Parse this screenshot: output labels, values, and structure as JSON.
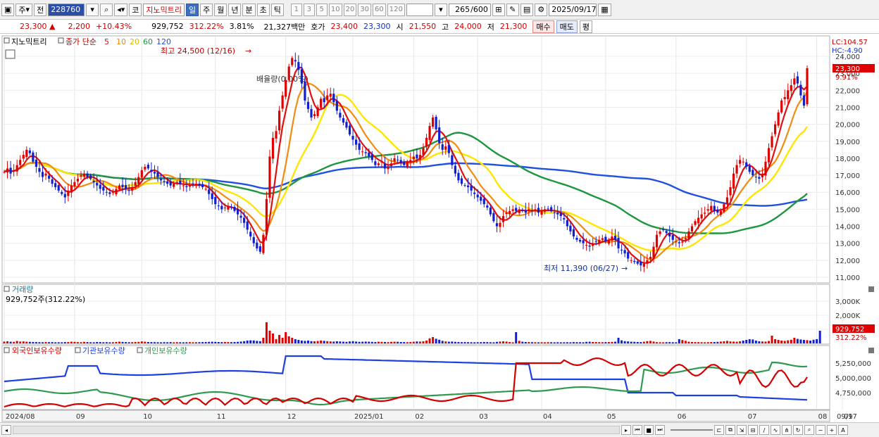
{
  "toolbar": {
    "market_label": "주",
    "prev_label": "전",
    "code": "228760",
    "type_label": "코",
    "stock_name": "지노믹트리",
    "period_tabs": [
      "일",
      "주",
      "월",
      "년",
      "분",
      "초",
      "틱"
    ],
    "active_period": "일",
    "intervals": [
      "1",
      "3",
      "5",
      "10",
      "20",
      "30",
      "60",
      "120"
    ],
    "count": "265",
    "count_total": "/600",
    "date": "2025/09/17"
  },
  "info": {
    "price": "23,300",
    "change": "2,200",
    "change_pct": "+10.43%",
    "volume": "929,752",
    "volume_pct": "312.22%",
    "turnover": "3.81%",
    "amount": "21,327백만",
    "quote_label": "호가",
    "ask": "23,400",
    "bid": "23,300",
    "open_label": "시",
    "open": "21,550",
    "high_label": "고",
    "high": "24,000",
    "low_label": "저",
    "low": "21,300",
    "buy_label": "매수",
    "sell_label": "매도",
    "eval_label": "평"
  },
  "price_panel": {
    "name": "지노믹트리",
    "ma_title": "종가 단순",
    "ma_periods": [
      "5",
      "10",
      "20",
      "60",
      "120"
    ],
    "ma_colors": [
      "#e01010",
      "#f08c10",
      "#ffe600",
      "#1e9640",
      "#2050e0"
    ],
    "high_annotation": "최고 24,500 (12/16)",
    "low_annotation": "최저 11,390 (06/27)",
    "ratio_label": "배율량(0.00%)",
    "lc": "LC:104.57",
    "hc": "HC:-4.90",
    "current_price": "23,300",
    "current_pct": "9.91%",
    "y_ticks": [
      "24,000",
      "23,000",
      "22,000",
      "21,000",
      "20,000",
      "19,000",
      "18,000",
      "17,000",
      "16,000",
      "15,000",
      "14,000",
      "13,000",
      "12,000",
      "11,000"
    ]
  },
  "volume_panel": {
    "title": "거래량",
    "value": "929,752주(312.22%)",
    "y_ticks": [
      "3,000K",
      "2,000K",
      "1,000K"
    ],
    "current": "929,752",
    "current_pct": "312.22%"
  },
  "holdings_panel": {
    "series": [
      "외국인보유수량",
      "기관보유수량",
      "개인보유수량"
    ],
    "colors": [
      "#d40000",
      "#1e40e0",
      "#2e9a50"
    ],
    "y_ticks": [
      "5,250,000",
      "5,000,000",
      "4,750,000"
    ]
  },
  "x_labels": [
    "2024/08",
    "09",
    "10",
    "11",
    "12",
    "2025/01",
    "02",
    "03",
    "04",
    "05",
    "06",
    "07",
    "08",
    "09",
    "09/17"
  ],
  "chart_data": {
    "type": "candlestick",
    "ylim": [
      11000,
      24500
    ],
    "closes": [
      17200,
      17400,
      17100,
      17300,
      17600,
      17900,
      18200,
      18500,
      18300,
      17800,
      17500,
      17200,
      16900,
      17100,
      16800,
      16500,
      16300,
      16100,
      15900,
      15700,
      16100,
      16400,
      16600,
      16800,
      17000,
      17100,
      16900,
      16800,
      16600,
      16400,
      16200,
      16100,
      16000,
      15900,
      16000,
      16200,
      16400,
      16300,
      16200,
      16100,
      16300,
      16600,
      16900,
      17300,
      17500,
      17400,
      17200,
      17100,
      16900,
      16700,
      16600,
      16500,
      16400,
      16500,
      16600,
      16500,
      16400,
      16300,
      16400,
      16500,
      16500,
      16400,
      16300,
      16200,
      15900,
      15600,
      15300,
      15200,
      15000,
      15100,
      15200,
      15100,
      14900,
      14700,
      14500,
      14200,
      13800,
      13400,
      13000,
      12700,
      12500,
      13500,
      15600,
      18100,
      19200,
      19600,
      20800,
      21700,
      22600,
      23400,
      23900,
      23700,
      23200,
      22400,
      21400,
      20900,
      20400,
      20600,
      21000,
      21500,
      21300,
      21700,
      21800,
      21300,
      20800,
      20400,
      20100,
      19800,
      19400,
      19100,
      18800,
      18500,
      18400,
      18300,
      18100,
      17900,
      17600,
      17700,
      17800,
      17400,
      17500,
      17700,
      18000,
      17900,
      17700,
      17600,
      17800,
      17900,
      18100,
      18000,
      18200,
      18600,
      19200,
      19900,
      20400,
      19700,
      18900,
      18500,
      18700,
      18300,
      17600,
      17100,
      16700,
      16500,
      16400,
      16300,
      16100,
      15900,
      15700,
      15500,
      15300,
      15100,
      14700,
      14300,
      14000,
      14200,
      14600,
      14800,
      14900,
      15000,
      14900,
      15000,
      14900,
      14800,
      15000,
      14900,
      15000,
      14800,
      14900,
      15000,
      15000,
      14900,
      14800,
      14700,
      14600,
      14400,
      14000,
      13700,
      13400,
      13200,
      13100,
      13000,
      12900,
      12800,
      13000,
      13100,
      13200,
      13300,
      13100,
      13200,
      13400,
      13200,
      12700,
      12600,
      12400,
      12100,
      12000,
      11900,
      11800,
      11700,
      11800,
      12000,
      12200,
      12800,
      13500,
      13700,
      13800,
      13600,
      13400,
      13200,
      13100,
      13000,
      13100,
      13300,
      13700,
      14000,
      14300,
      14500,
      14700,
      14800,
      15000,
      15200,
      14900,
      14800,
      14900,
      15300,
      15700,
      16300,
      17100,
      17600,
      17900,
      17800,
      17500,
      17200,
      17000,
      16900,
      16800,
      17100,
      17800,
      18600,
      19300,
      20000,
      20700,
      21400,
      21600,
      22000,
      22300,
      22700,
      22400,
      21700,
      21100,
      23300
    ],
    "volume_values": [
      130,
      150,
      120,
      110,
      170,
      130,
      140,
      120,
      110,
      100,
      95,
      90,
      85,
      100,
      90,
      95,
      80,
      85,
      80,
      95,
      100,
      120,
      110,
      90,
      85,
      110,
      95,
      85,
      80,
      100,
      95,
      85,
      90,
      80,
      85,
      100,
      120,
      105,
      95,
      85,
      90,
      100,
      110,
      140,
      120,
      100,
      95,
      90,
      85,
      80,
      90,
      85,
      95,
      80,
      90,
      85,
      80,
      85,
      90,
      80,
      85,
      90,
      95,
      100,
      110,
      120,
      110,
      100,
      95,
      100,
      95,
      90,
      100,
      110,
      130,
      160,
      200,
      220,
      210,
      180,
      160,
      400,
      1500,
      900,
      700,
      300,
      600,
      400,
      800,
      500,
      400,
      300,
      250,
      200,
      180,
      200,
      160,
      150,
      170,
      200,
      180,
      160,
      140,
      130,
      150,
      140,
      120,
      110,
      140,
      160,
      130,
      110,
      120,
      130,
      120,
      110,
      100,
      120,
      110,
      100,
      90,
      110,
      120,
      115,
      100,
      95,
      90,
      100,
      120,
      140,
      130,
      150,
      200,
      360,
      450,
      330,
      260,
      180,
      140,
      120,
      130,
      110,
      100,
      90,
      95,
      90,
      85,
      80,
      85,
      90,
      100,
      95,
      85,
      80,
      110,
      130,
      150,
      130,
      95,
      80,
      800,
      180,
      120,
      100,
      95,
      90,
      85,
      80,
      85,
      80,
      90,
      85,
      80,
      85,
      80,
      80,
      85,
      80,
      95,
      90,
      85,
      80,
      110,
      120,
      100,
      95,
      90,
      85,
      95,
      100,
      110,
      120,
      400,
      220,
      160,
      140,
      120,
      110,
      100,
      95,
      120,
      160,
      180,
      130,
      90,
      85,
      80,
      90,
      95,
      85,
      80,
      300,
      240,
      180,
      120,
      100,
      95,
      90,
      85,
      80,
      90,
      95,
      100,
      110,
      130,
      150,
      180,
      140,
      130,
      120,
      150,
      200,
      250,
      300,
      280,
      200,
      150,
      140,
      130,
      170,
      550,
      300,
      250,
      200,
      180,
      220,
      260,
      400,
      320,
      280,
      250,
      230,
      200,
      260,
      300,
      900
    ]
  }
}
